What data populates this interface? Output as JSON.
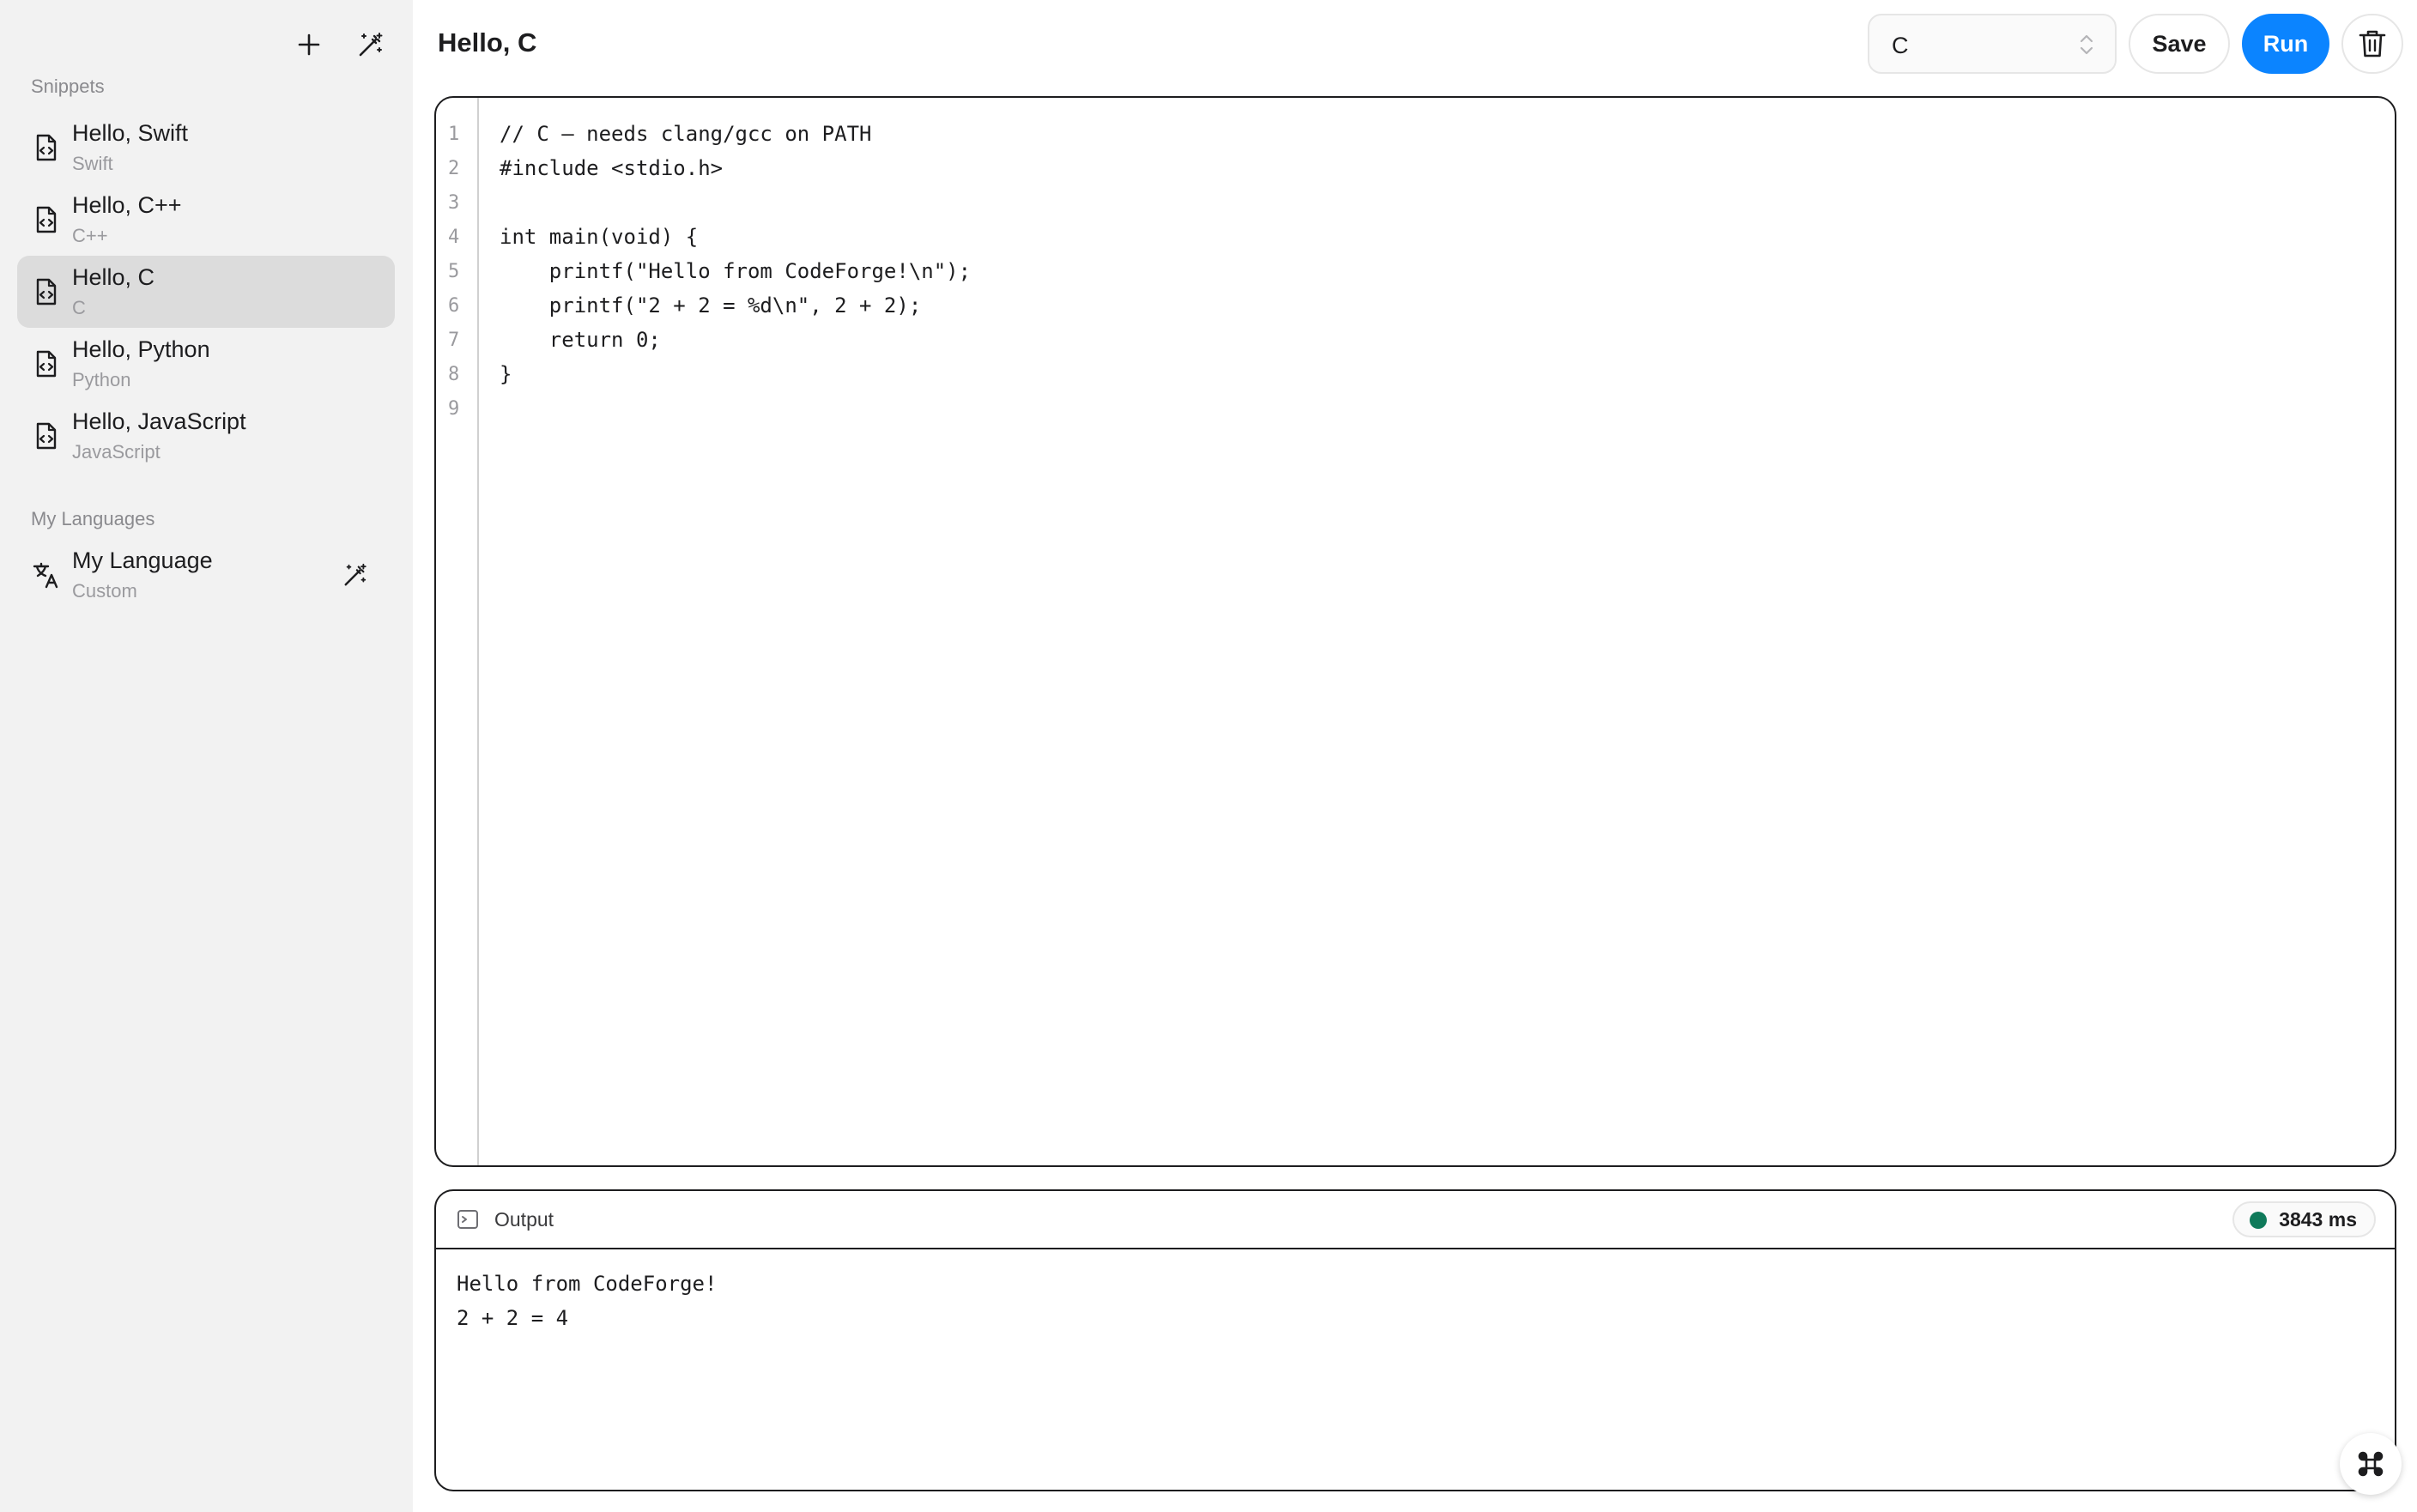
{
  "sidebar": {
    "sections": {
      "snippets": "Snippets",
      "languages": "My Languages"
    },
    "snippets": [
      {
        "title": "Hello, Swift",
        "lang": "Swift"
      },
      {
        "title": "Hello, C++",
        "lang": "C++"
      },
      {
        "title": "Hello, C",
        "lang": "C"
      },
      {
        "title": "Hello, Python",
        "lang": "Python"
      },
      {
        "title": "Hello, JavaScript",
        "lang": "JavaScript"
      }
    ],
    "active_index": 2,
    "languages": [
      {
        "title": "My Language",
        "sub": "Custom"
      }
    ],
    "icons": [
      "plus-icon",
      "magic-wand-icon",
      "code-file-icon",
      "translate-icon"
    ]
  },
  "header": {
    "title": "Hello, C",
    "language_value": "C",
    "save_label": "Save",
    "run_label": "Run",
    "accent_color": "#0b84ff"
  },
  "editor": {
    "line_numbers": [
      "1",
      "2",
      "3",
      "4",
      "5",
      "6",
      "7",
      "8",
      "9"
    ],
    "lines": [
      "// C — needs clang/gcc on PATH",
      "#include <stdio.h>",
      "",
      "int main(void) {",
      "    printf(\"Hello from CodeForge!\\n\");",
      "    printf(\"2 + 2 = %d\\n\", 2 + 2);",
      "    return 0;",
      "}",
      ""
    ]
  },
  "output": {
    "label": "Output",
    "timing": "3843 ms",
    "status_color": "#0f7a5a",
    "lines": [
      "Hello from CodeForge!",
      "2 + 2 = 4"
    ]
  }
}
